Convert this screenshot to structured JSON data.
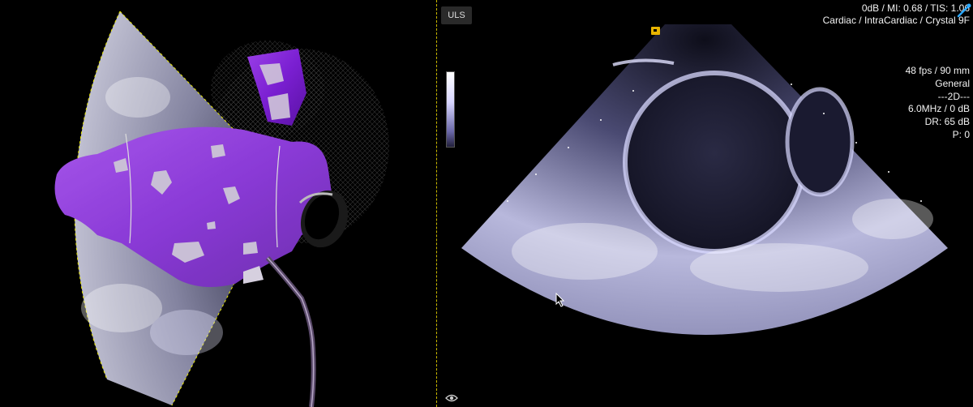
{
  "status_bar": {
    "line1": "0dB / MI: 0.68 / TIS: 1.06",
    "line2": "Cardiac / IntraCardiac / Crystal 9F"
  },
  "mode_badge": "ULS",
  "image_params": [
    "48 fps / 90 mm",
    "General",
    "---2D---",
    "6.0MHz / 0 dB",
    "DR: 65 dB",
    "P: 0"
  ],
  "colors": {
    "background": "#000000",
    "divider": "#c9b800",
    "model_purple": "#7a1fd1",
    "ultrasound_tint": "#c8c8ff",
    "text": "#f2f2f2"
  },
  "icons": {
    "orientation_marker": "orientation-marker-icon",
    "visibility": "eye-icon",
    "probe": "probe-icon",
    "cursor": "mouse-cursor-icon"
  }
}
